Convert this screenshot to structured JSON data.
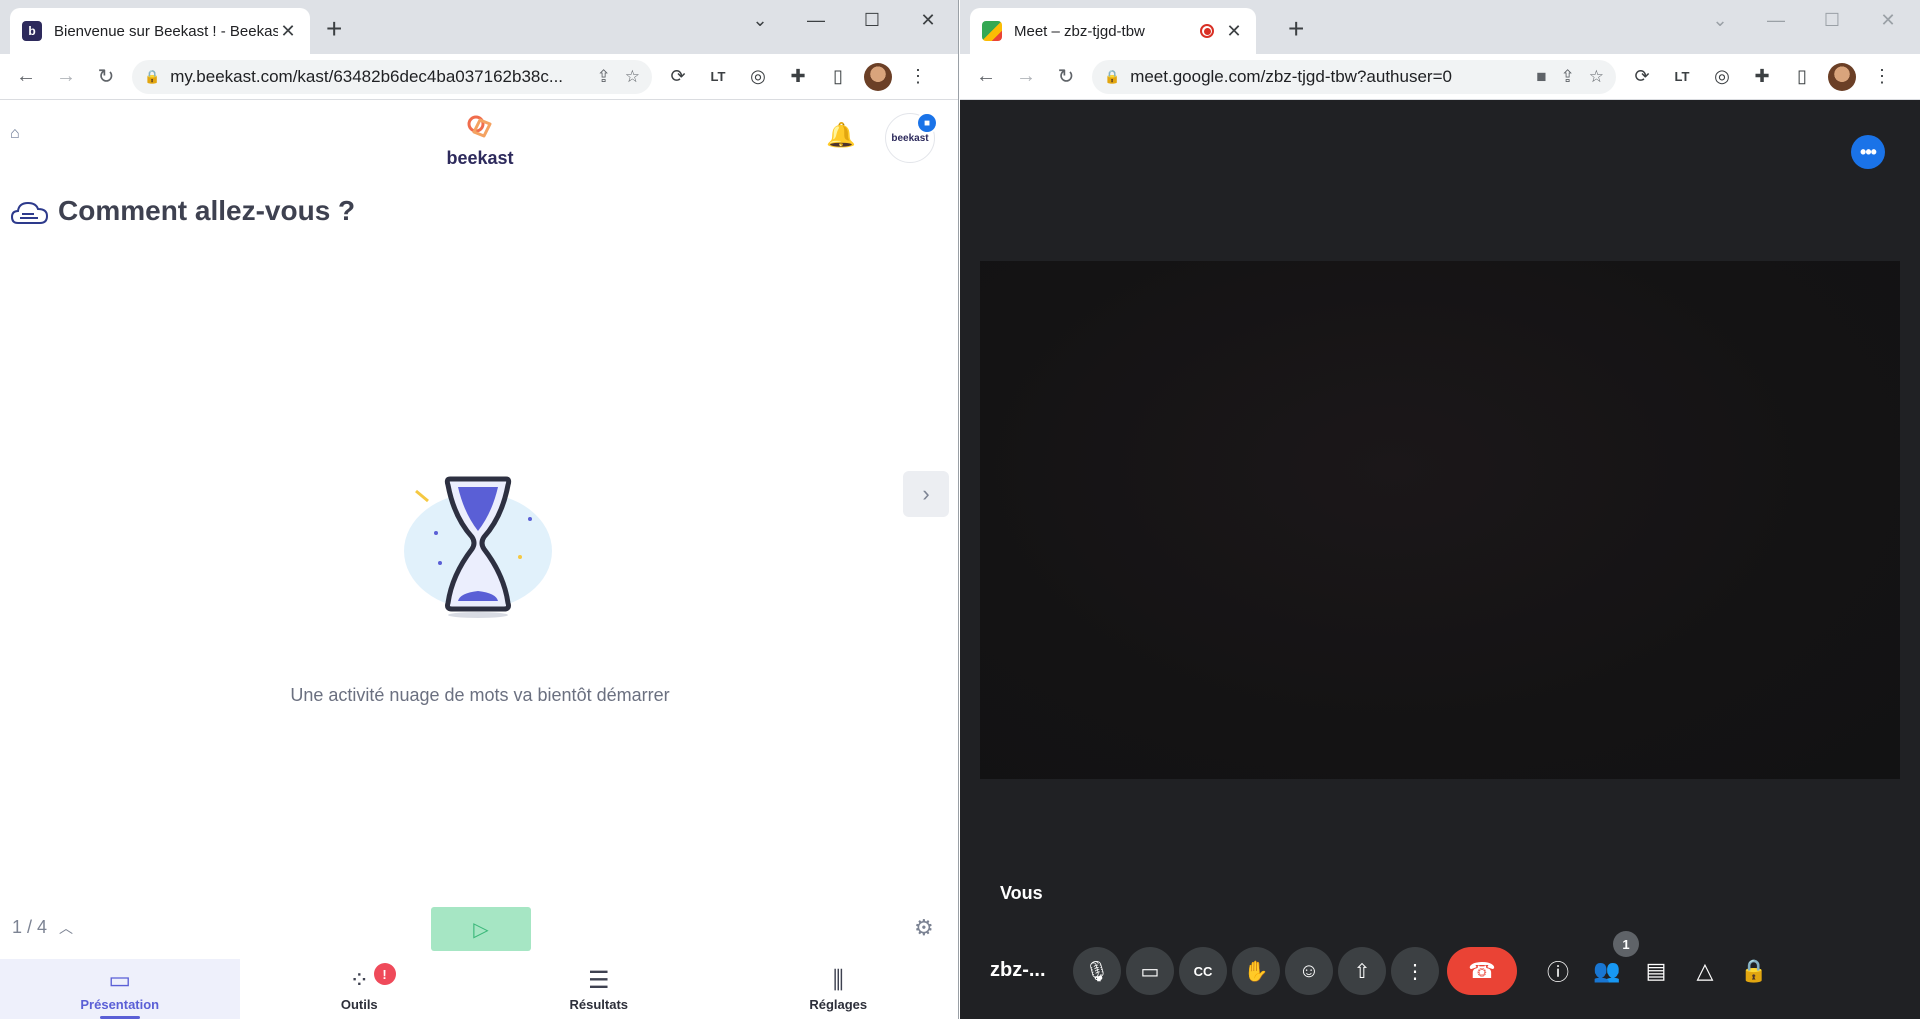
{
  "beekast_browser": {
    "tab_title": "Bienvenue sur Beekast ! - Beekast",
    "url": "my.beekast.com/kast/63482b6dec4ba037162b38c..."
  },
  "beekast": {
    "logo_text": "beekast",
    "org_logo_text": "beekast",
    "question": "Comment allez-vous ?",
    "waiting_message": "Une activité nuage de mots va bientôt démarrer",
    "pager": "1 / 4",
    "nav": [
      {
        "label": "Présentation",
        "active": true
      },
      {
        "label": "Outils",
        "alert": "!"
      },
      {
        "label": "Résultats"
      },
      {
        "label": "Réglages"
      }
    ],
    "colors": {
      "accent": "#5a5fd6",
      "play": "#a6e6c4",
      "alert": "#ef4a5a"
    }
  },
  "meet_browser": {
    "tab_title": "Meet – zbz-tjgd-tbw",
    "url": "meet.google.com/zbz-tjgd-tbw?authuser=0"
  },
  "meet": {
    "self_label": "Vous",
    "meeting_code": "zbz-...",
    "participants_count": "1",
    "colors": {
      "end_call": "#ea4335",
      "more": "#1a73e8"
    }
  }
}
